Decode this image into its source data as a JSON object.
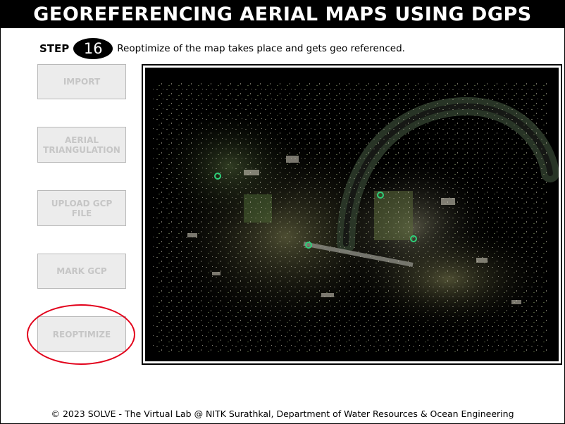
{
  "header": {
    "title": "GEOREFERENCING AERIAL MAPS USING DGPS"
  },
  "step": {
    "label": "STEP",
    "number": "16",
    "description": "Reoptimize of the map takes place and gets geo referenced."
  },
  "sidebar": {
    "buttons": [
      {
        "label": "IMPORT"
      },
      {
        "label": "AERIAL TRIANGULATION"
      },
      {
        "label": "UPLOAD GCP FILE"
      },
      {
        "label": "MARK GCP"
      },
      {
        "label": "REOPTIMIZE"
      }
    ]
  },
  "map": {
    "gcp_marker_color": "#2fd07a",
    "background": "#000000"
  },
  "footer": {
    "text": "© 2023 SOLVE - The Virtual Lab @ NITK Surathkal, Department of Water Resources & Ocean Engineering"
  },
  "colors": {
    "highlight": "#e2001a",
    "button_text_disabled": "#c6c6c6"
  }
}
